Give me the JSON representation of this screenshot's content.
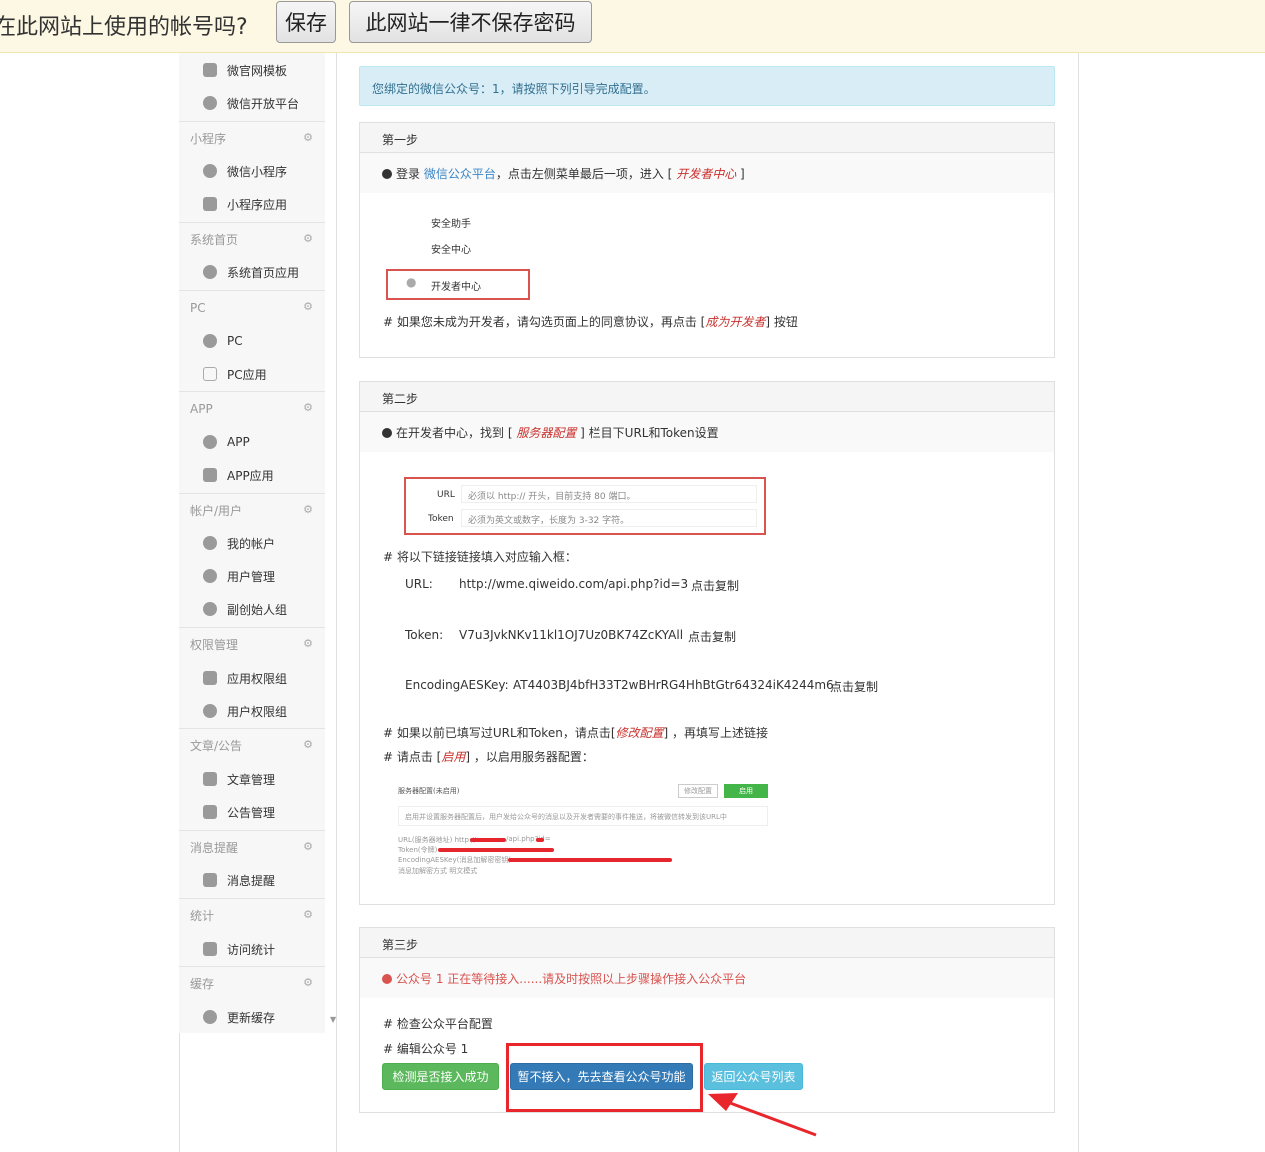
{
  "password_bar": {
    "question": "在此网站上使用的帐号吗?",
    "save_label": "保存",
    "never_label": "此网站一律不保存密码"
  },
  "sidebar": {
    "top_items": [
      "微官网模板",
      "微信开放平台"
    ],
    "groups": [
      {
        "title": "小程序",
        "items": [
          "微信小程序",
          "小程序应用"
        ]
      },
      {
        "title": "系统首页",
        "items": [
          "系统首页应用"
        ]
      },
      {
        "title": "PC",
        "items": [
          "PC",
          "PC应用"
        ]
      },
      {
        "title": "APP",
        "items": [
          "APP",
          "APP应用"
        ]
      },
      {
        "title": "帐户/用户",
        "items": [
          "我的帐户",
          "用户管理",
          "副创始人组"
        ]
      },
      {
        "title": "权限管理",
        "items": [
          "应用权限组",
          "用户权限组"
        ]
      },
      {
        "title": "文章/公告",
        "items": [
          "文章管理",
          "公告管理"
        ]
      },
      {
        "title": "消息提醒",
        "items": [
          "消息提醒"
        ]
      },
      {
        "title": "统计",
        "items": [
          "访问统计"
        ]
      },
      {
        "title": "缓存",
        "items": [
          "更新缓存"
        ]
      }
    ],
    "gear_icon": "⚙"
  },
  "alert": "您绑定的微信公众号：1，请按照下列引导完成配置。",
  "step1": {
    "title": "第一步",
    "line_pre": "登录",
    "line_link": "微信公众平台",
    "line_mid": "，点击左侧菜单最后一项，进入 [",
    "line_em": "开发者中心",
    "line_end": "]",
    "menu_items": [
      "安全助手",
      "安全中心",
      "开发者中心"
    ],
    "note_pre": "# 如果您未成为开发者，请勾选页面上的同意协议，再点击 [",
    "note_em": "成为开发者",
    "note_end": "] 按钮"
  },
  "step2": {
    "title": "第二步",
    "line_pre": "在开发者中心，找到 [",
    "line_em": "服务器配置",
    "line_end": "] 栏目下URL和Token设置",
    "fake_url_label": "URL",
    "fake_url_ph": "必须以 http:// 开头，目前支持 80 端口。",
    "fake_token_label": "Token",
    "fake_token_ph": "必须为英文或数字，长度为 3-32 字符。",
    "fill_note": "# 将以下链接链接填入对应输入框：",
    "url_label": "URL:",
    "url_value": "http://wme.qiweido.com/api.php?id=3",
    "token_label": "Token:",
    "token_value": "V7u3JvkNKv11kl1OJ7Uz0BK74ZcKYAll",
    "aes_label": "EncodingAESKey:",
    "aes_value": "AT4403BJ4bfH33T2wBHrRG4HhBtGtr64324iK4244m6",
    "copy_label": "点击复制",
    "modify_pre": "# 如果以前已填写过URL和Token，请点击[",
    "modify_em": "修改配置",
    "modify_end": "] ，再填写上述链接",
    "enable_pre": "# 请点击 [",
    "enable_em": "启用",
    "enable_end": "] ，以启用服务器配置：",
    "fake2_title": "服务器配置(未启用)",
    "fake2_modify": "修改配置",
    "fake2_enable": "启用",
    "fake2_desc": "启用并设置服务器配置后，用户发给公众号的消息以及开发者需要的事件推送，将被微信转发到该URL中",
    "fake2_url": "URL(服务器地址)   http://",
    "fake2_url_tail": "/api.php?id=",
    "fake2_token": "Token(令牌)",
    "fake2_aes": "EncodingAESKey(消息加解密密钥)",
    "fake2_mode": "消息加解密方式    明文模式"
  },
  "step3": {
    "title": "第三步",
    "status": "公众号 1 正在等待接入......请及时按照以上步骤操作接入公众平台",
    "check_note": "# 检查公众平台配置",
    "edit_note": "# 编辑公众号 1",
    "btn_check": "检测是否接入成功",
    "btn_skip": "暂不接入，先去查看公众号功能",
    "btn_back": "返回公众号列表"
  },
  "colors": {
    "accent_red": "#d9534f",
    "link_blue": "#3a86c8",
    "alert_bg": "#d9edf7"
  }
}
